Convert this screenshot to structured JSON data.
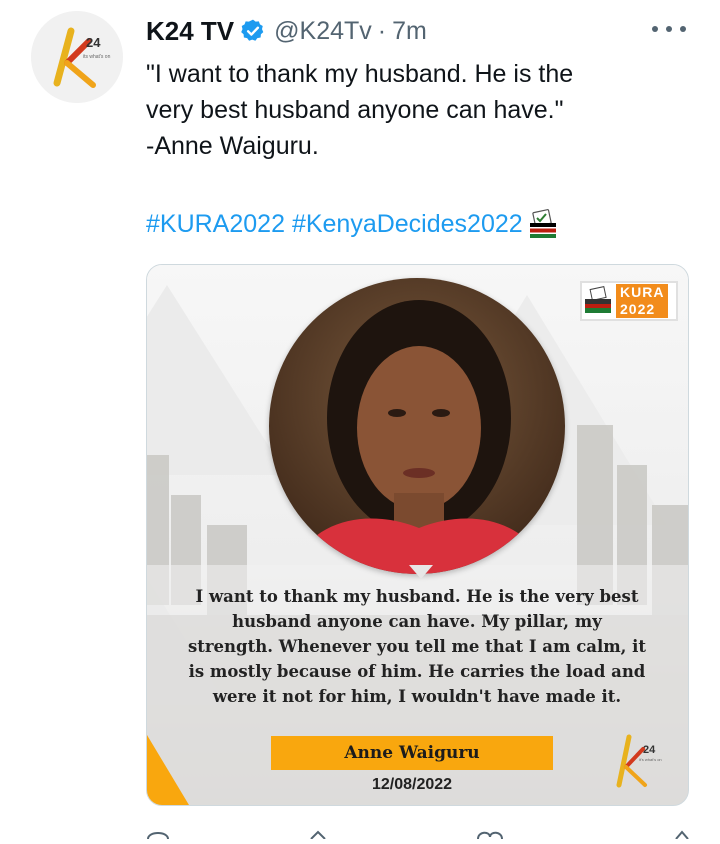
{
  "tweet": {
    "author_name": "K24 TV",
    "handle": "@K24Tv",
    "separator": "·",
    "time": "7m",
    "text_lines": [
      "\"I want to thank my husband. He is the",
      "very best husband anyone can have.\"",
      "-Anne Waiguru."
    ],
    "hashtags": [
      "#KURA2022",
      "#KenyaDecides2022"
    ],
    "emoji": "ballot-box-with-kenya-flag"
  },
  "avatar": {
    "logo_text": "24",
    "tagline": "its what's on"
  },
  "card": {
    "badge_line1": "KURA",
    "badge_line2": "2022",
    "quote": "I want to thank my husband. He is the very best husband anyone can have. My pillar, my strength. Whenever you tell me that I am calm, it is mostly because of him. He carries the load and were it not for him, I wouldn't have made it.",
    "person_name": "Anne Waiguru",
    "date": "12/08/2022",
    "logo_text": "24",
    "logo_tagline": "it's what's on"
  },
  "colors": {
    "link": "#1d9bf0",
    "verified": "#1d9bf0",
    "brand_orange": "#f9a70e",
    "muted": "#536471"
  },
  "icons": [
    "verified-icon",
    "more-icon",
    "ballot-icon",
    "kura-ballot-icon",
    "k24-logo"
  ]
}
